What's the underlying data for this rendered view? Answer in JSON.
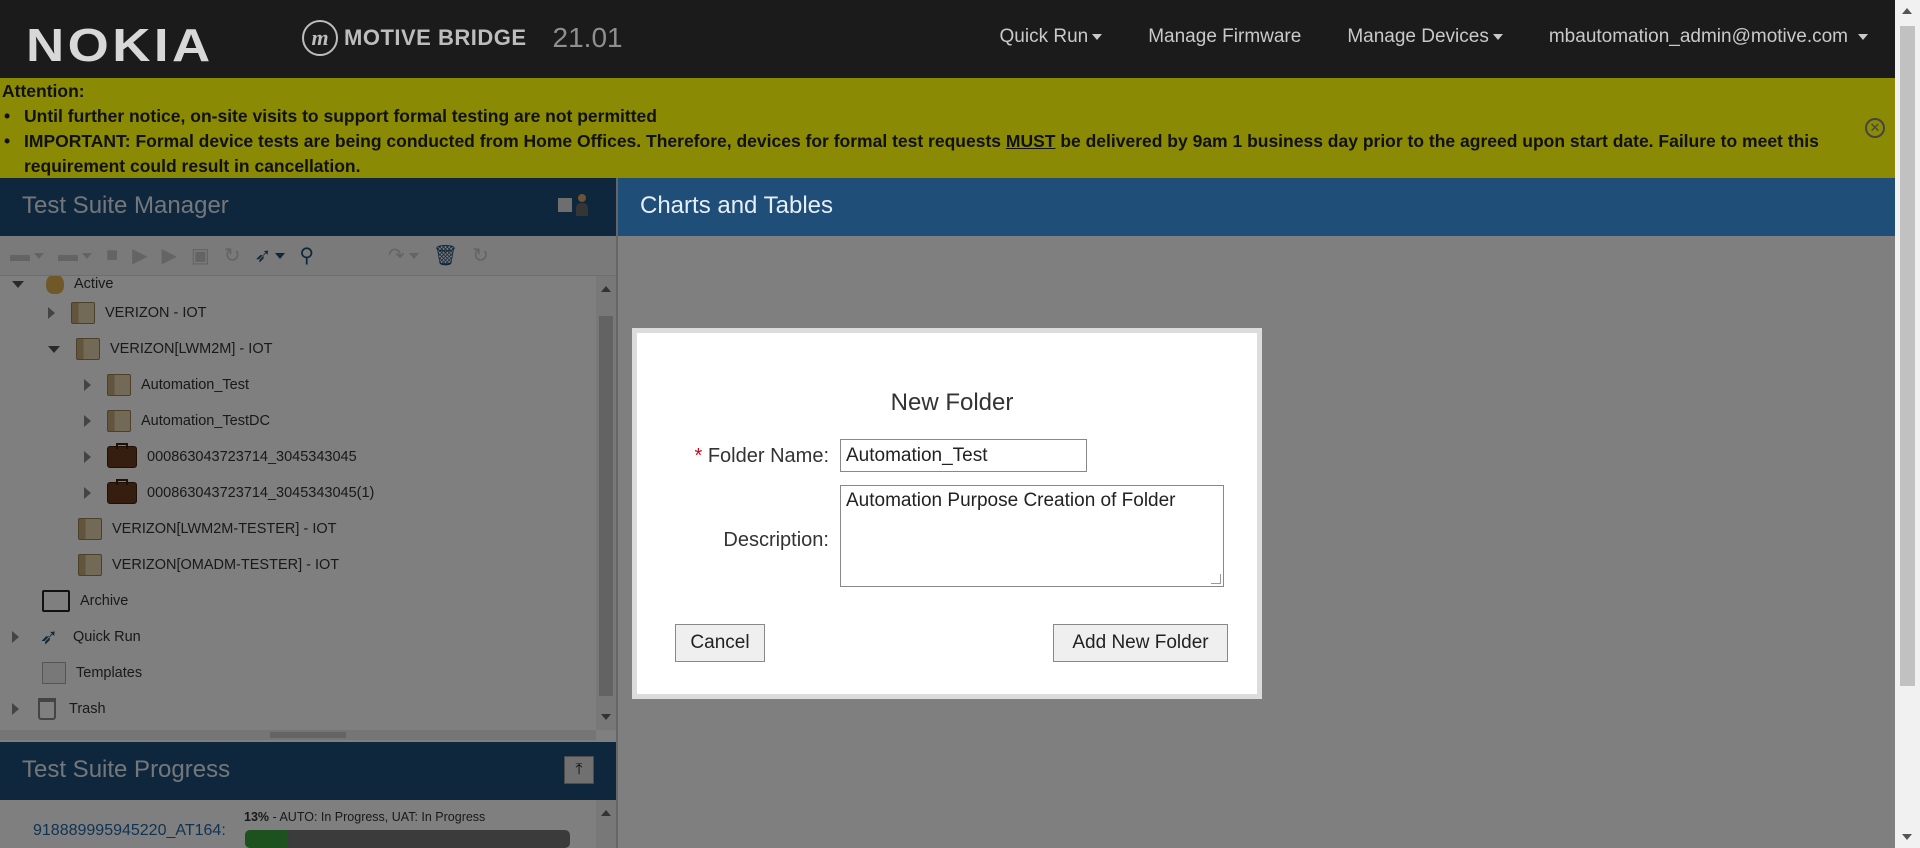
{
  "topbar": {
    "brand": "NOKIA",
    "product_mark": "m",
    "product": "MOTIVE BRIDGE",
    "version": "21.01",
    "nav": [
      {
        "label": "Quick Run",
        "dropdown": true
      },
      {
        "label": "Manage Firmware",
        "dropdown": false
      },
      {
        "label": "Manage Devices",
        "dropdown": true
      },
      {
        "label": "mbautomation_admin@motive.com",
        "dropdown": true
      }
    ]
  },
  "banner": {
    "heading": "Attention:",
    "line1": "Until further notice, on-site visits to support formal testing are not permitted",
    "line2_before": "IMPORTANT: Formal device tests are being conducted from Home Offices. Therefore, devices for formal test requests ",
    "line2_must": "MUST",
    "line2_after": " be delivered by 9am 1 business day prior to the agreed upon start date. Failure to meet this requirement could result in cancellation.",
    "close_icon": "close-circle-icon",
    "color": "#8a8a05"
  },
  "left_panel": {
    "title": "Test Suite Manager",
    "tree": [
      {
        "label": "Active",
        "indent": 0,
        "toggle": "down",
        "icon": "bulb"
      },
      {
        "label": "VERIZON - IOT",
        "indent": 1,
        "toggle": "right",
        "icon": "book"
      },
      {
        "label": "VERIZON[LWM2M] - IOT",
        "indent": 1,
        "toggle": "down",
        "icon": "book"
      },
      {
        "label": "Automation_Test",
        "indent": 2,
        "toggle": "right",
        "icon": "book"
      },
      {
        "label": "Automation_TestDC",
        "indent": 2,
        "toggle": "right",
        "icon": "book"
      },
      {
        "label": "000863043723714_3045343045",
        "indent": 2,
        "toggle": "right",
        "icon": "case"
      },
      {
        "label": "000863043723714_3045343045(1)",
        "indent": 2,
        "toggle": "right",
        "icon": "case"
      },
      {
        "label": "VERIZON[LWM2M-TESTER] - IOT",
        "indent": 1,
        "toggle": "none",
        "icon": "book"
      },
      {
        "label": "VERIZON[OMADM-TESTER] - IOT",
        "indent": 1,
        "toggle": "none",
        "icon": "book"
      },
      {
        "label": "Archive",
        "indent": 0,
        "toggle": "none",
        "icon": "folder"
      },
      {
        "label": "Quick Run",
        "indent": 0,
        "toggle": "right",
        "icon": "rocket"
      },
      {
        "label": "Templates",
        "indent": 0,
        "toggle": "none",
        "icon": "template"
      },
      {
        "label": "Trash",
        "indent": 0,
        "toggle": "right",
        "icon": "trash"
      }
    ]
  },
  "progress_panel": {
    "title": "Test Suite Progress",
    "item_link": "918889995945220_AT164:",
    "percent_label": "13%",
    "status": " - AUTO: In Progress, UAT: In Progress",
    "percent": 0.13
  },
  "right_panel": {
    "title": "Charts and Tables"
  },
  "modal": {
    "title": "New Folder",
    "required_mark": "*",
    "folder_name_label": "Folder Name:",
    "folder_name_value": "Automation_Test",
    "description_label": "Description:",
    "description_value": "Automation Purpose Creation of Folder",
    "cancel_label": "Cancel",
    "add_label": "Add New Folder"
  },
  "colors": {
    "header_blue": "#1f4e79",
    "topbar": "#1b1b1b",
    "progress_green": "#3ba33b"
  }
}
